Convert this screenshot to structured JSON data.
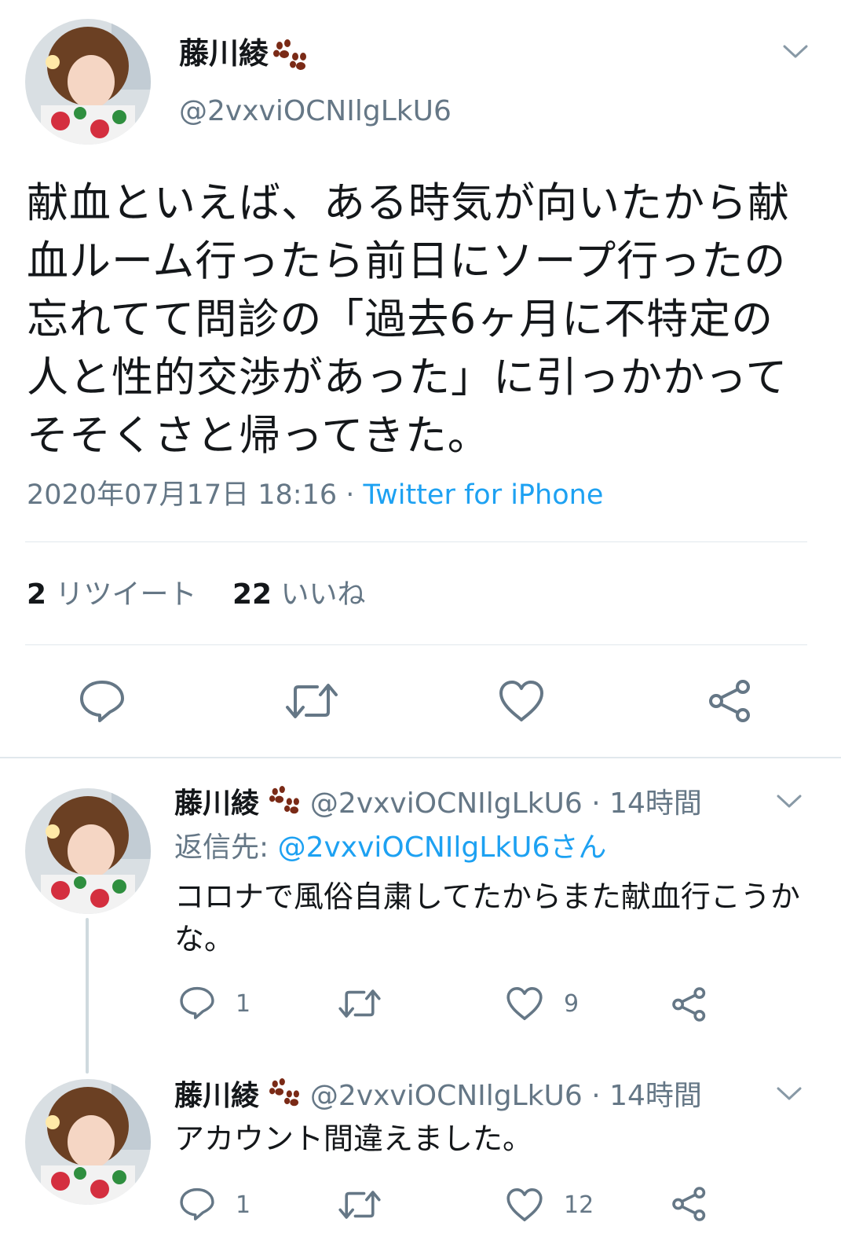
{
  "main_tweet": {
    "display_name": "藤川綾",
    "handle": "@2vxviOCNIlgLkU6",
    "text": "献血といえば、ある時気が向いたから献血ルーム行ったら前日にソープ行ったの忘れてて問診の「過去6ヶ月に不特定の人と性的交渉があった」に引っかかってそそくさと帰ってきた。",
    "timestamp": "2020年07月17日 18:16",
    "separator": " · ",
    "source": "Twitter for iPhone",
    "retweet_count": "2",
    "retweet_label": "リツイート",
    "like_count": "22",
    "like_label": "いいね"
  },
  "replies": [
    {
      "display_name": "藤川綾",
      "handle": "@2vxviOCNIlgLkU6",
      "time": "14時間",
      "reply_to_prefix": "返信先: ",
      "reply_to_handle": "@2vxviOCNIlgLkU6さん",
      "text": "コロナで風俗自粛してたからまた献血行こうかな。",
      "reply_count": "1",
      "retweet_count": "",
      "like_count": "9"
    },
    {
      "display_name": "藤川綾",
      "handle": "@2vxviOCNIlgLkU6",
      "time": "14時間",
      "text": "アカウント間違えました。",
      "reply_count": "1",
      "retweet_count": "",
      "like_count": "12"
    }
  ],
  "colors": {
    "accent": "#1da1f2",
    "secondary_text": "#657786",
    "divider": "#e1e8ed",
    "paw": "#7a2a16"
  }
}
